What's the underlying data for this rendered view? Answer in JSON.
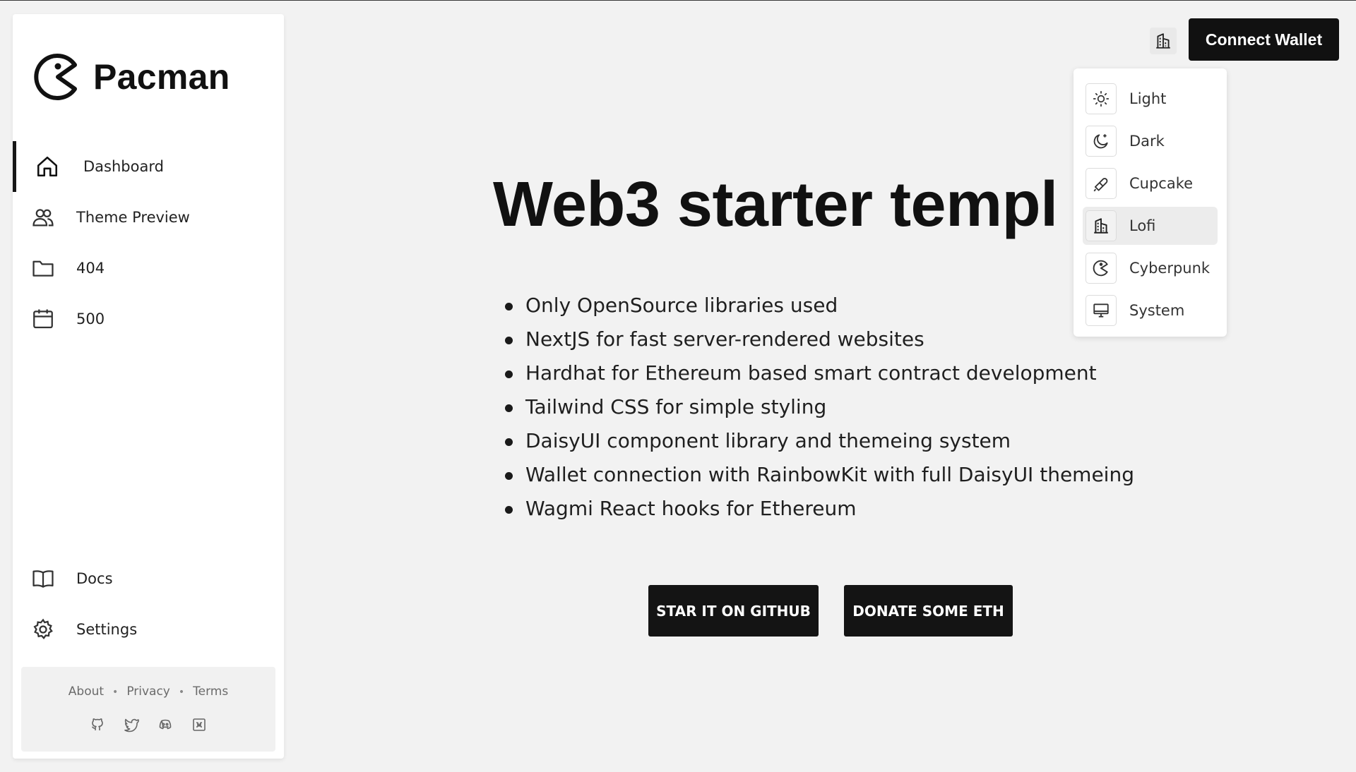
{
  "sidebar": {
    "brand": "Pacman",
    "nav": [
      {
        "label": "Dashboard",
        "icon": "home-icon"
      },
      {
        "label": "Theme Preview",
        "icon": "users-icon"
      },
      {
        "label": "404",
        "icon": "folder-icon"
      },
      {
        "label": "500",
        "icon": "calendar-icon"
      }
    ],
    "bottom_nav": [
      {
        "label": "Docs",
        "icon": "book-icon"
      },
      {
        "label": "Settings",
        "icon": "gear-icon"
      }
    ],
    "footer": {
      "links": [
        "About",
        "Privacy",
        "Terms"
      ],
      "separator": "•",
      "icons": [
        "github-icon",
        "twitter-icon",
        "discord-icon",
        "medium-icon"
      ]
    }
  },
  "header": {
    "connect_wallet": "Connect Wallet",
    "theme_toggle_icon": "building-icon"
  },
  "theme_menu": {
    "selected": "Lofi",
    "items": [
      {
        "label": "Light",
        "icon": "sun-icon"
      },
      {
        "label": "Dark",
        "icon": "moon-icon"
      },
      {
        "label": "Cupcake",
        "icon": "cupcake-icon"
      },
      {
        "label": "Lofi",
        "icon": "building-icon"
      },
      {
        "label": "Cyberpunk",
        "icon": "pacman-icon"
      },
      {
        "label": "System",
        "icon": "monitor-icon"
      }
    ]
  },
  "main": {
    "title": "Web3 starter templ",
    "features": [
      "Only OpenSource libraries used",
      "NextJS for fast server-rendered websites",
      "Hardhat for Ethereum based smart contract development",
      "Tailwind CSS for simple styling",
      "DaisyUI component library and themeing system",
      "Wallet connection with RainbowKit with full DaisyUI themeing",
      "Wagmi React hooks for Ethereum"
    ],
    "buttons": {
      "github": "STAR IT ON GITHUB",
      "donate": "DONATE SOME ETH"
    }
  },
  "colors": {
    "background": "#f2f2f2",
    "panel": "#ffffff",
    "primary": "#111111",
    "text": "#1a1a1a",
    "muted": "#6b6b6b"
  }
}
